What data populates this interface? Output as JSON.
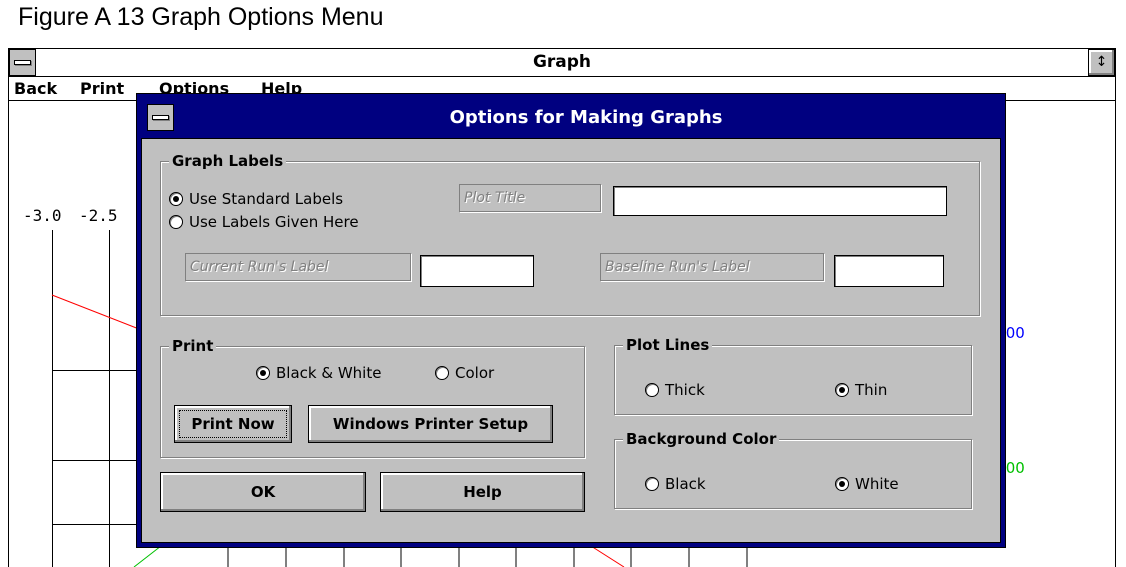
{
  "caption": "Figure A 13  Graph Options Menu",
  "main_window": {
    "title": "Graph",
    "menu": [
      "Back",
      "Print",
      "Options",
      "Help"
    ]
  },
  "graph": {
    "x_tick_labels": [
      "-3.0",
      "-2.5"
    ],
    "side_values": [
      ".00",
      ".00"
    ],
    "colors": {
      "red": "#ff0000",
      "green": "#00c000",
      "blue": "#0000ff"
    }
  },
  "dialog": {
    "title": "Options for Making Graphs",
    "graph_labels": {
      "group_label": "Graph Labels",
      "option_standard": "Use Standard Labels",
      "option_given": "Use Labels Given Here",
      "selected": "Use Standard Labels",
      "plot_title_label": "Plot Title",
      "plot_title_value": "",
      "current_run_label": "Current Run's Label",
      "current_run_value": "",
      "baseline_run_label": "Baseline Run's Label",
      "baseline_run_value": ""
    },
    "print": {
      "group_label": "Print",
      "option_bw": "Black & White",
      "option_color": "Color",
      "selected": "Black & White",
      "print_now": "Print Now",
      "printer_setup": "Windows Printer Setup"
    },
    "plot_lines": {
      "group_label": "Plot Lines",
      "option_thick": "Thick",
      "option_thin": "Thin",
      "selected": "Thin"
    },
    "background_color": {
      "group_label": "Background Color",
      "option_black": "Black",
      "option_white": "White",
      "selected": "White"
    },
    "ok": "OK",
    "help": "Help"
  },
  "title_bar_color": "#000080",
  "dialog_face_color": "#c0c0c0"
}
